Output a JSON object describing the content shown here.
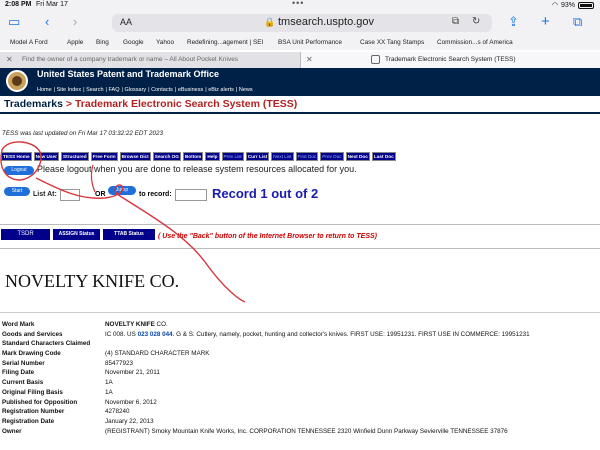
{
  "status_bar": {
    "time": "2:08 PM",
    "date": "Fri Mar 17",
    "battery": "93%"
  },
  "browser": {
    "address_prefix": "AA",
    "url": "tmsearch.uspto.gov",
    "bookmarks": [
      "Model A Ford",
      "Apple",
      "Bing",
      "Google",
      "Yahoo",
      "Redefining...agement | SEI",
      "BSA Unit Performance",
      "Case XX Tang Stamps",
      "Commission...s of America"
    ],
    "tabs": [
      {
        "title": "Find the owner of a company trademark or name – All About Pocket Knives",
        "active": false
      },
      {
        "title": "Trademark Electronic Search System (TESS)",
        "active": true
      }
    ]
  },
  "uspto": {
    "org_name": "United States Patent and Trademark Office",
    "links": [
      "Home",
      "Site Index",
      "Search",
      "FAQ",
      "Glossary",
      "Contacts",
      "eBusiness",
      "eBiz alerts",
      "News"
    ]
  },
  "page": {
    "breadcrumb_trademarks": "Trademarks",
    "breadcrumb_sep": " > ",
    "breadcrumb_tess": "Trademark Electronic Search System (TESS)",
    "updated": "TESS was last updated on Fri Mar 17 03:32:22 EDT 2023",
    "nav_buttons": [
      {
        "label": "TESS Home",
        "dim": false
      },
      {
        "label": "New User",
        "dim": false
      },
      {
        "label": "Structured",
        "dim": false
      },
      {
        "label": "Free Form",
        "dim": false
      },
      {
        "label": "Browse Dict",
        "dim": false
      },
      {
        "label": "Search OG",
        "dim": false
      },
      {
        "label": "Bottom",
        "dim": false
      },
      {
        "label": "Help",
        "dim": false
      },
      {
        "label": "Prev List",
        "dim": true
      },
      {
        "label": "Curr List",
        "dim": false
      },
      {
        "label": "Next List",
        "dim": true
      },
      {
        "label": "First Doc",
        "dim": true
      },
      {
        "label": "Prev Doc",
        "dim": true
      },
      {
        "label": "Next Doc",
        "dim": false
      },
      {
        "label": "Last Doc",
        "dim": false
      }
    ],
    "logout_label": "Logout",
    "logout_message": "Please logout when you are done to release system resources allocated for you.",
    "start_label": "Start",
    "list_at_label": "List At:",
    "or_label": "OR",
    "jump_label": "Jump",
    "to_record_label": "to record:",
    "record_text": "Record 1 out of 2",
    "tsdr_label": "TSDR",
    "assign_label": "ASSIGN Status",
    "ttab_label": "TTAB Status",
    "back_note": "( Use the \"Back\" button of the Internet Browser to return to TESS)",
    "mark_display": "NOVELTY KNIFE CO."
  },
  "fields": [
    {
      "label": "Word Mark",
      "value_bold": "NOVELTY KNIFE",
      "value": " CO."
    },
    {
      "label": "Goods and Services",
      "prefix": "IC 008. US ",
      "classes": "023 028 044",
      "value": ". G & S: Cutlery, namely, pocket, hunting and collector's knives. FIRST USE: 19951231. FIRST USE IN COMMERCE: 19951231"
    },
    {
      "label": "Standard Characters Claimed",
      "value": ""
    },
    {
      "label": "Mark Drawing Code",
      "value": "(4) STANDARD CHARACTER MARK"
    },
    {
      "label": "Serial Number",
      "value": "85477923"
    },
    {
      "label": "Filing Date",
      "value": "November 21, 2011"
    },
    {
      "label": "Current Basis",
      "value": "1A"
    },
    {
      "label": "Original Filing Basis",
      "value": "1A"
    },
    {
      "label": "Published for Opposition",
      "value": "November 6, 2012"
    },
    {
      "label": "Registration Number",
      "value": "4278240"
    },
    {
      "label": "Registration Date",
      "value": "January 22, 2013"
    },
    {
      "label": "Owner",
      "value": "(REGISTRANT) Smoky Mountain Knife Works, Inc. CORPORATION TENNESSEE 2320 Winfield Dunn Parkway Sevierville TENNESSEE 37876"
    }
  ],
  "colors": {
    "header_navy": "#002147",
    "button_navy": "#00008b",
    "breadcrumb_red": "#b22222",
    "annotation_red": "#d8343c"
  }
}
